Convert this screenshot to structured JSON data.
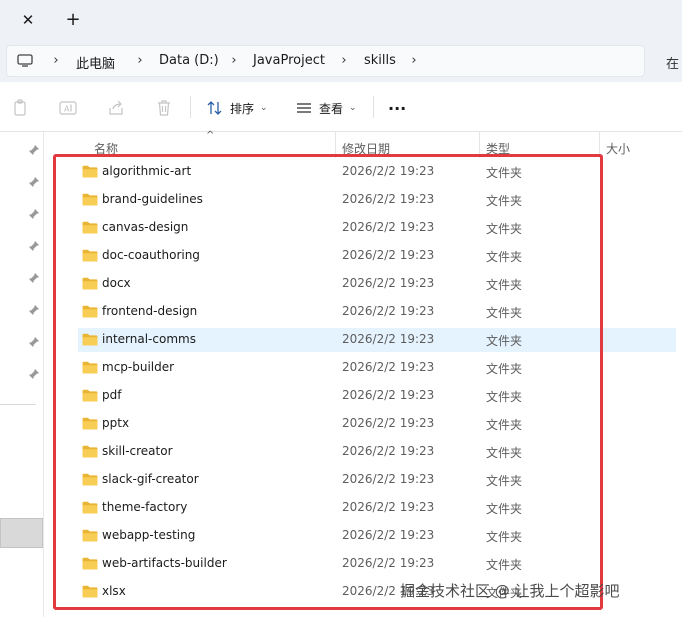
{
  "tabstrip": {
    "close_glyph": "✕",
    "new_tab_glyph": "+"
  },
  "address": {
    "pc_icon": "computer-icon",
    "crumbs": [
      "此电脑",
      "Data (D:)",
      "JavaProject",
      "skills"
    ],
    "separator": "›",
    "search_partial": "在"
  },
  "toolbar": {
    "sort_label": "排序",
    "view_label": "查看",
    "more_label": "···",
    "icons": [
      "copy-icon",
      "rename-icon",
      "share-icon",
      "delete-icon",
      "sort-icon",
      "view-icon",
      "more-icon"
    ]
  },
  "columns": {
    "name": "名称",
    "date": "修改日期",
    "type": "类型",
    "size": "大小",
    "sort_glyph": "^"
  },
  "files": [
    {
      "name": "algorithmic-art",
      "date": "2026/2/2 19:23",
      "type": "文件夹"
    },
    {
      "name": "brand-guidelines",
      "date": "2026/2/2 19:23",
      "type": "文件夹"
    },
    {
      "name": "canvas-design",
      "date": "2026/2/2 19:23",
      "type": "文件夹"
    },
    {
      "name": "doc-coauthoring",
      "date": "2026/2/2 19:23",
      "type": "文件夹"
    },
    {
      "name": "docx",
      "date": "2026/2/2 19:23",
      "type": "文件夹"
    },
    {
      "name": "frontend-design",
      "date": "2026/2/2 19:23",
      "type": "文件夹"
    },
    {
      "name": "internal-comms",
      "date": "2026/2/2 19:23",
      "type": "文件夹",
      "selected": true
    },
    {
      "name": "mcp-builder",
      "date": "2026/2/2 19:23",
      "type": "文件夹"
    },
    {
      "name": "pdf",
      "date": "2026/2/2 19:23",
      "type": "文件夹"
    },
    {
      "name": "pptx",
      "date": "2026/2/2 19:23",
      "type": "文件夹"
    },
    {
      "name": "skill-creator",
      "date": "2026/2/2 19:23",
      "type": "文件夹"
    },
    {
      "name": "slack-gif-creator",
      "date": "2026/2/2 19:23",
      "type": "文件夹"
    },
    {
      "name": "theme-factory",
      "date": "2026/2/2 19:23",
      "type": "文件夹"
    },
    {
      "name": "webapp-testing",
      "date": "2026/2/2 19:23",
      "type": "文件夹"
    },
    {
      "name": "web-artifacts-builder",
      "date": "2026/2/2 19:23",
      "type": "文件夹"
    },
    {
      "name": "xlsx",
      "date": "2026/2/2 19:23",
      "type": "文件夹"
    }
  ],
  "watermark": "掘金技术社区 @ 让我上个超影吧",
  "colors": {
    "selection": "#e5f3ff",
    "folder": "#f5c342",
    "annotation_red": "#e0393e"
  }
}
